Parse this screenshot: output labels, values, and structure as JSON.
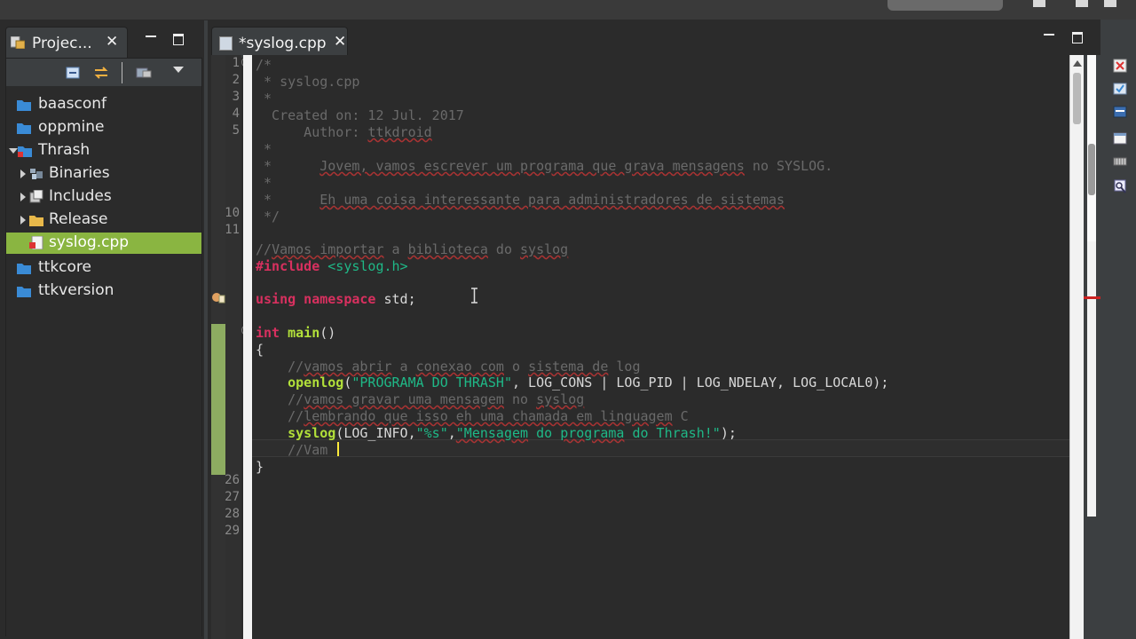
{
  "project_view": {
    "tab_label": "Projec...",
    "tab_close": "✕",
    "tree": [
      {
        "label": "baasconf",
        "level": 0,
        "twisty": "none",
        "icon": "project-folder-icon"
      },
      {
        "label": "oppmine",
        "level": 0,
        "twisty": "none",
        "icon": "project-folder-icon"
      },
      {
        "label": "Thrash",
        "level": 0,
        "twisty": "open",
        "icon": "project-folder-icon"
      },
      {
        "label": "Binaries",
        "level": 1,
        "twisty": "closed",
        "icon": "binaries-icon"
      },
      {
        "label": "Includes",
        "level": 1,
        "twisty": "closed",
        "icon": "includes-icon"
      },
      {
        "label": "Release",
        "level": 1,
        "twisty": "closed",
        "icon": "folder-icon"
      },
      {
        "label": "syslog.cpp",
        "level": 1,
        "twisty": "none",
        "icon": "cpp-file-error-icon",
        "selected": true
      },
      {
        "label": "ttkcore",
        "level": 0,
        "twisty": "none",
        "icon": "project-folder-icon"
      },
      {
        "label": "ttkversion",
        "level": 0,
        "twisty": "none",
        "icon": "project-folder-icon"
      }
    ]
  },
  "editor": {
    "tab_label": "*syslog.cpp",
    "tab_close": "✕",
    "visible_line_numbers": [
      "1",
      "2",
      "3",
      "4",
      "5",
      "10",
      "11",
      "26",
      "27",
      "28",
      "29"
    ],
    "code": {
      "l1": "/*",
      "l2": " * syslog.cpp",
      "l3": " *",
      "l4": "  Created on: 12 Jul. 2017",
      "l5a": "      Author: ",
      "l5b": "ttkdroid",
      "l6": " *",
      "l7a": " *      ",
      "l7b": "Jovem, vamos escrever um programa que grava mensagens",
      "l7c": " no SYSLOG.",
      "l8": " *",
      "l9a": " *      ",
      "l9b": "Eh uma coisa interessante para administradores de sistemas",
      "l10": " */",
      "l12a": "//",
      "l12b": "Vamos importar",
      "l12c": " a ",
      "l12d": "biblioteca",
      "l12e": " do ",
      "l12f": "syslog",
      "l13a": "#include",
      "l13b": " <syslog.h>",
      "l15a": "using namespace",
      "l15b": " std;",
      "l17a": "int",
      "l17b": " main",
      "l17c": "()",
      "l18": "{",
      "l19a": "    //",
      "l19b": "vamos abrir",
      "l19c": " a ",
      "l19d": "conexao com",
      "l19e": " o ",
      "l19f": "sistema de",
      "l19g": " log",
      "l20a": "    openlog",
      "l20b": "(",
      "l20c": "\"PROGRAMA DO THRASH\"",
      "l20d": ", LOG_CONS | LOG_PID | LOG_NDELAY, LOG_LOCAL0);",
      "l21a": "    //",
      "l21b": "vamos gravar uma mensagem",
      "l21c": " no ",
      "l21d": "syslog",
      "l22a": "    //",
      "l22b": "lembrando que isso eh uma chamada em linguagem",
      "l22c": " C",
      "l23a": "    syslog",
      "l23b": "(LOG_INFO,",
      "l23c": "\"%s\"",
      "l23d": ",",
      "l23e": "\"Mensagem",
      "l23f": " do ",
      "l23g": "programa",
      "l23h": " do Thrash!\"",
      "l23i": ");",
      "l24": "    //Vam",
      "l25": "}"
    }
  },
  "colors": {
    "selection": "#8ab541",
    "keyword": "#d8305f",
    "string": "#1fb887",
    "function": "#b2e03a",
    "comment": "#6a6a6a",
    "change_bar": "#9dc26a",
    "caret": "#ffeb3b"
  }
}
